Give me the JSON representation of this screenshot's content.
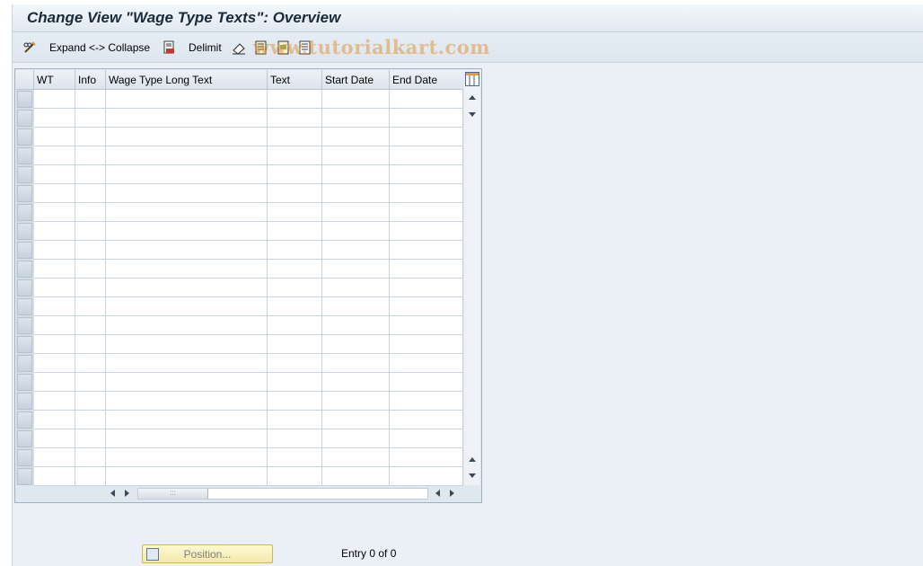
{
  "title": "Change View \"Wage Type Texts\": Overview",
  "toolbar": {
    "expand_collapse_label": "Expand <-> Collapse",
    "delimit_label": "Delimit"
  },
  "watermark": "www.tutorialkart.com",
  "table": {
    "columns": [
      "WT",
      "Info",
      "Wage Type Long Text",
      "Text",
      "Start Date",
      "End Date"
    ],
    "row_count": 21
  },
  "footer": {
    "position_button": "Position...",
    "entry_text": "Entry 0 of 0"
  },
  "icons": {
    "toggle_change": "pencil-glasses-icon",
    "expand": "document-icon",
    "delimit": "eraser-icon",
    "select_all": "select-all-icon",
    "select_block": "select-block-icon",
    "deselect_all": "deselect-all-icon",
    "column_config": "table-settings-icon"
  },
  "colors": {
    "background": "#eaf0f6",
    "position_button": "#f6eebb",
    "watermark": "#e2963c"
  }
}
